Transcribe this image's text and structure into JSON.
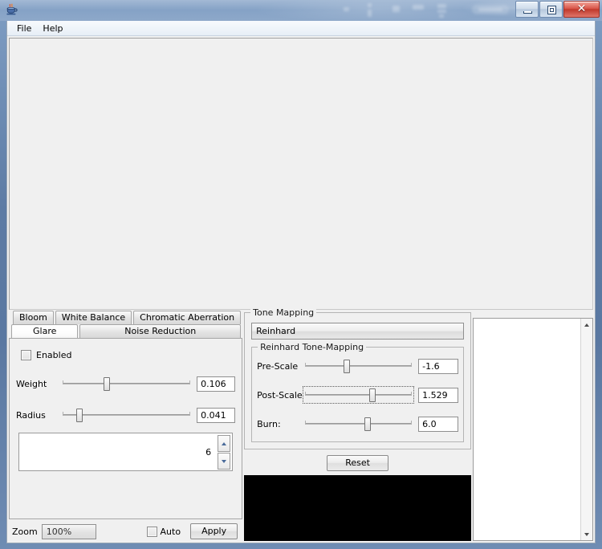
{
  "window": {
    "title": "",
    "icon": "java-coffee-cup-icon",
    "buttons": {
      "minimize": "minimize-icon",
      "restore": "restore-icon",
      "close": "✕"
    }
  },
  "menu": {
    "items": [
      {
        "label": "File"
      },
      {
        "label": "Help"
      }
    ]
  },
  "canvas": {
    "content": ""
  },
  "tabs": {
    "row1": [
      {
        "label": "Bloom",
        "selected": false
      },
      {
        "label": "White Balance",
        "selected": false
      },
      {
        "label": "Chromatic Aberration",
        "selected": false
      }
    ],
    "row2": [
      {
        "label": "Glare",
        "selected": true
      },
      {
        "label": "Noise Reduction",
        "selected": false
      }
    ]
  },
  "glare_panel": {
    "enabled_label": "Enabled",
    "enabled_checked": false,
    "sliders": [
      {
        "label": "Weight",
        "value": "0.106",
        "position": 35,
        "focused": false
      },
      {
        "label": "Radius",
        "value": "0.041",
        "position": 14,
        "focused": false
      }
    ],
    "spinner": {
      "value": "6",
      "up": "spinner-up-icon",
      "down": "spinner-down-icon"
    }
  },
  "bottom_bar": {
    "zoom_label": "Zoom",
    "zoom_value": "100%",
    "auto_label": "Auto",
    "auto_checked": false,
    "apply_label": "Apply"
  },
  "tone_mapping": {
    "group_title": "Tone Mapping",
    "selected_operator": "Reinhard",
    "sub_group_title": "Reinhard Tone-Mapping",
    "sliders": [
      {
        "label": "Pre-Scale",
        "value": "-1.6",
        "position": 39,
        "focused": false
      },
      {
        "label": "Post-Scale",
        "value": "1.529",
        "position": 63,
        "focused": true
      },
      {
        "label": "Burn:",
        "value": "6.0",
        "position": 58,
        "focused": false
      }
    ],
    "reset_label": "Reset",
    "histogram": "histogram-display"
  },
  "right_panel": {
    "items": [],
    "scrollbar": {
      "up": "scroll-up-icon",
      "down": "scroll-down-icon"
    }
  },
  "colors": {
    "title_bar": "#5d7ba4",
    "panel_bg": "#f0f0f0",
    "close_button": "#c0392c",
    "histogram_bg": "#000000",
    "field_bg": "#ffffff"
  }
}
